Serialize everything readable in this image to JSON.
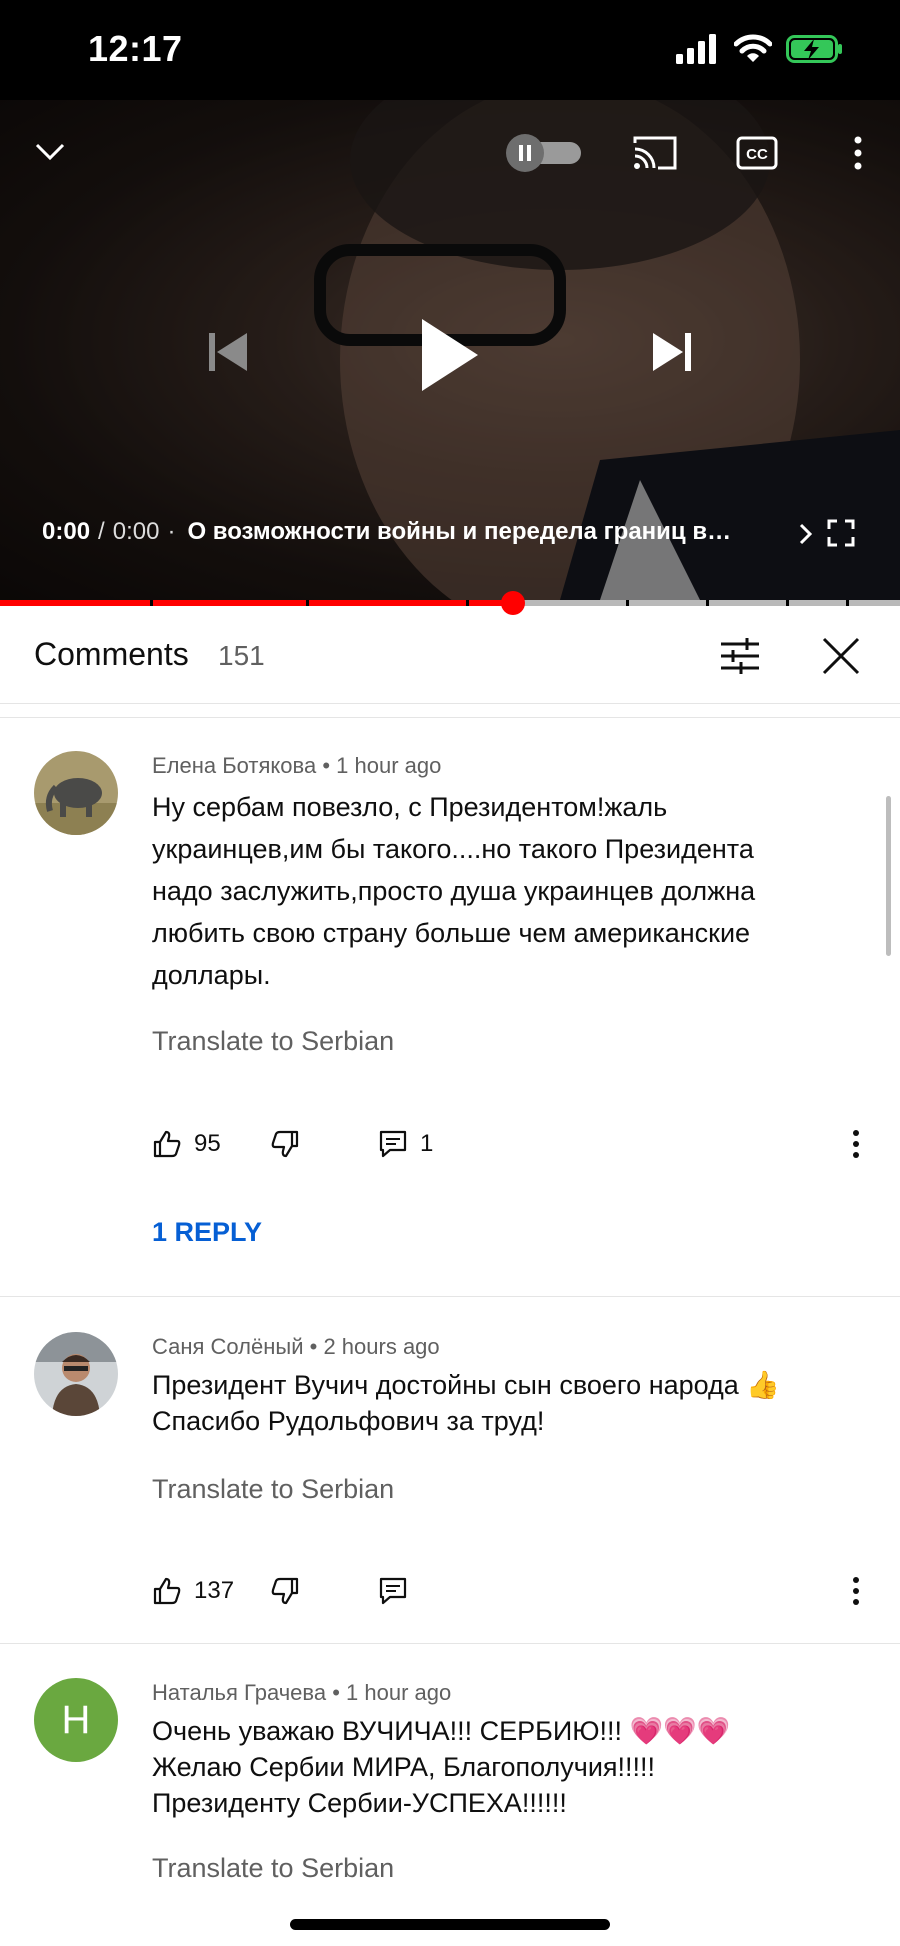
{
  "status_bar": {
    "time": "12:17"
  },
  "player": {
    "current_time": "0:00",
    "separator": "/",
    "duration": "0:00",
    "dot": "·",
    "title": "О возможности войны и передела границ в…",
    "progress_fraction": 0.57
  },
  "comments_header": {
    "title": "Comments",
    "count": "151"
  },
  "comments": [
    {
      "author": "Елена Ботякова",
      "time": "1 hour ago",
      "text_lines": [
        "Ну сербам повезло, с Президентом!жаль",
        "украинцев,им бы такого....но такого Президента",
        "надо заслужить,просто душа украинцев должна",
        "любить свою страну больше чем американские",
        "доллары."
      ],
      "translate": "Translate to Serbian",
      "likes": "95",
      "reply_count": "1",
      "replies_link": "1 REPLY"
    },
    {
      "author": "Саня Солёный",
      "time": "2 hours ago",
      "text_lines": [
        "Президент Вучич достойны сын своего народа 👍",
        "Спасибо Рудольфович за труд!"
      ],
      "translate": "Translate to Serbian",
      "likes": "137"
    },
    {
      "author": "Наталья Грачева",
      "time": "1 hour ago",
      "avatar_letter": "Н",
      "text_lines": [
        "Очень уважаю ВУЧИЧА!!! СЕРБИЮ!!! 💗💗💗",
        "Желаю Сербии МИРА, Благополучия!!!!!",
        "Президенту Сербии-УСПЕХА!!!!!!"
      ],
      "translate": "Translate to Serbian"
    }
  ],
  "colors": {
    "accent_red": "#ff0000",
    "link_blue": "#065fd4",
    "battery_green": "#34c759",
    "avatar_green": "#6aa840"
  }
}
